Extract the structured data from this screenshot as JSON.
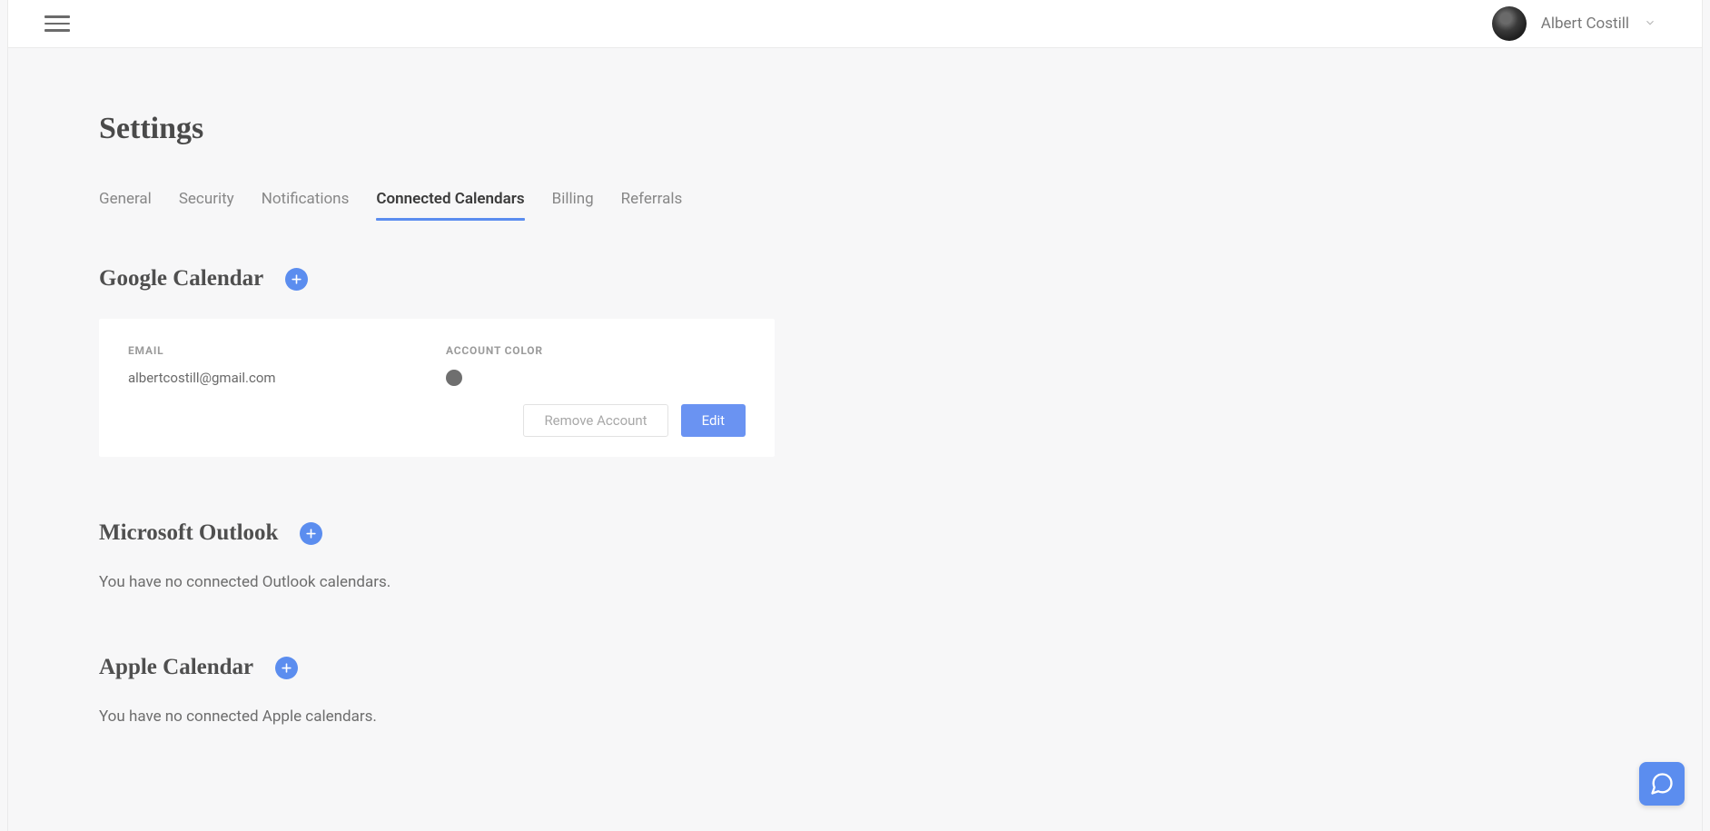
{
  "header": {
    "user_name": "Albert Costill"
  },
  "page": {
    "title": "Settings"
  },
  "tabs": [
    {
      "label": "General",
      "active": false
    },
    {
      "label": "Security",
      "active": false
    },
    {
      "label": "Notifications",
      "active": false
    },
    {
      "label": "Connected Calendars",
      "active": true
    },
    {
      "label": "Billing",
      "active": false
    },
    {
      "label": "Referrals",
      "active": false
    }
  ],
  "sections": {
    "google": {
      "title": "Google Calendar",
      "account": {
        "email_label": "EMAIL",
        "email_value": "albertcostill@gmail.com",
        "color_label": "ACCOUNT COLOR",
        "color_value": "#6f6f6f"
      },
      "remove_label": "Remove Account",
      "edit_label": "Edit"
    },
    "outlook": {
      "title": "Microsoft Outlook",
      "empty_text": "You have no connected Outlook calendars."
    },
    "apple": {
      "title": "Apple Calendar",
      "empty_text": "You have no connected Apple calendars."
    }
  },
  "colors": {
    "accent": "#5b8def"
  }
}
